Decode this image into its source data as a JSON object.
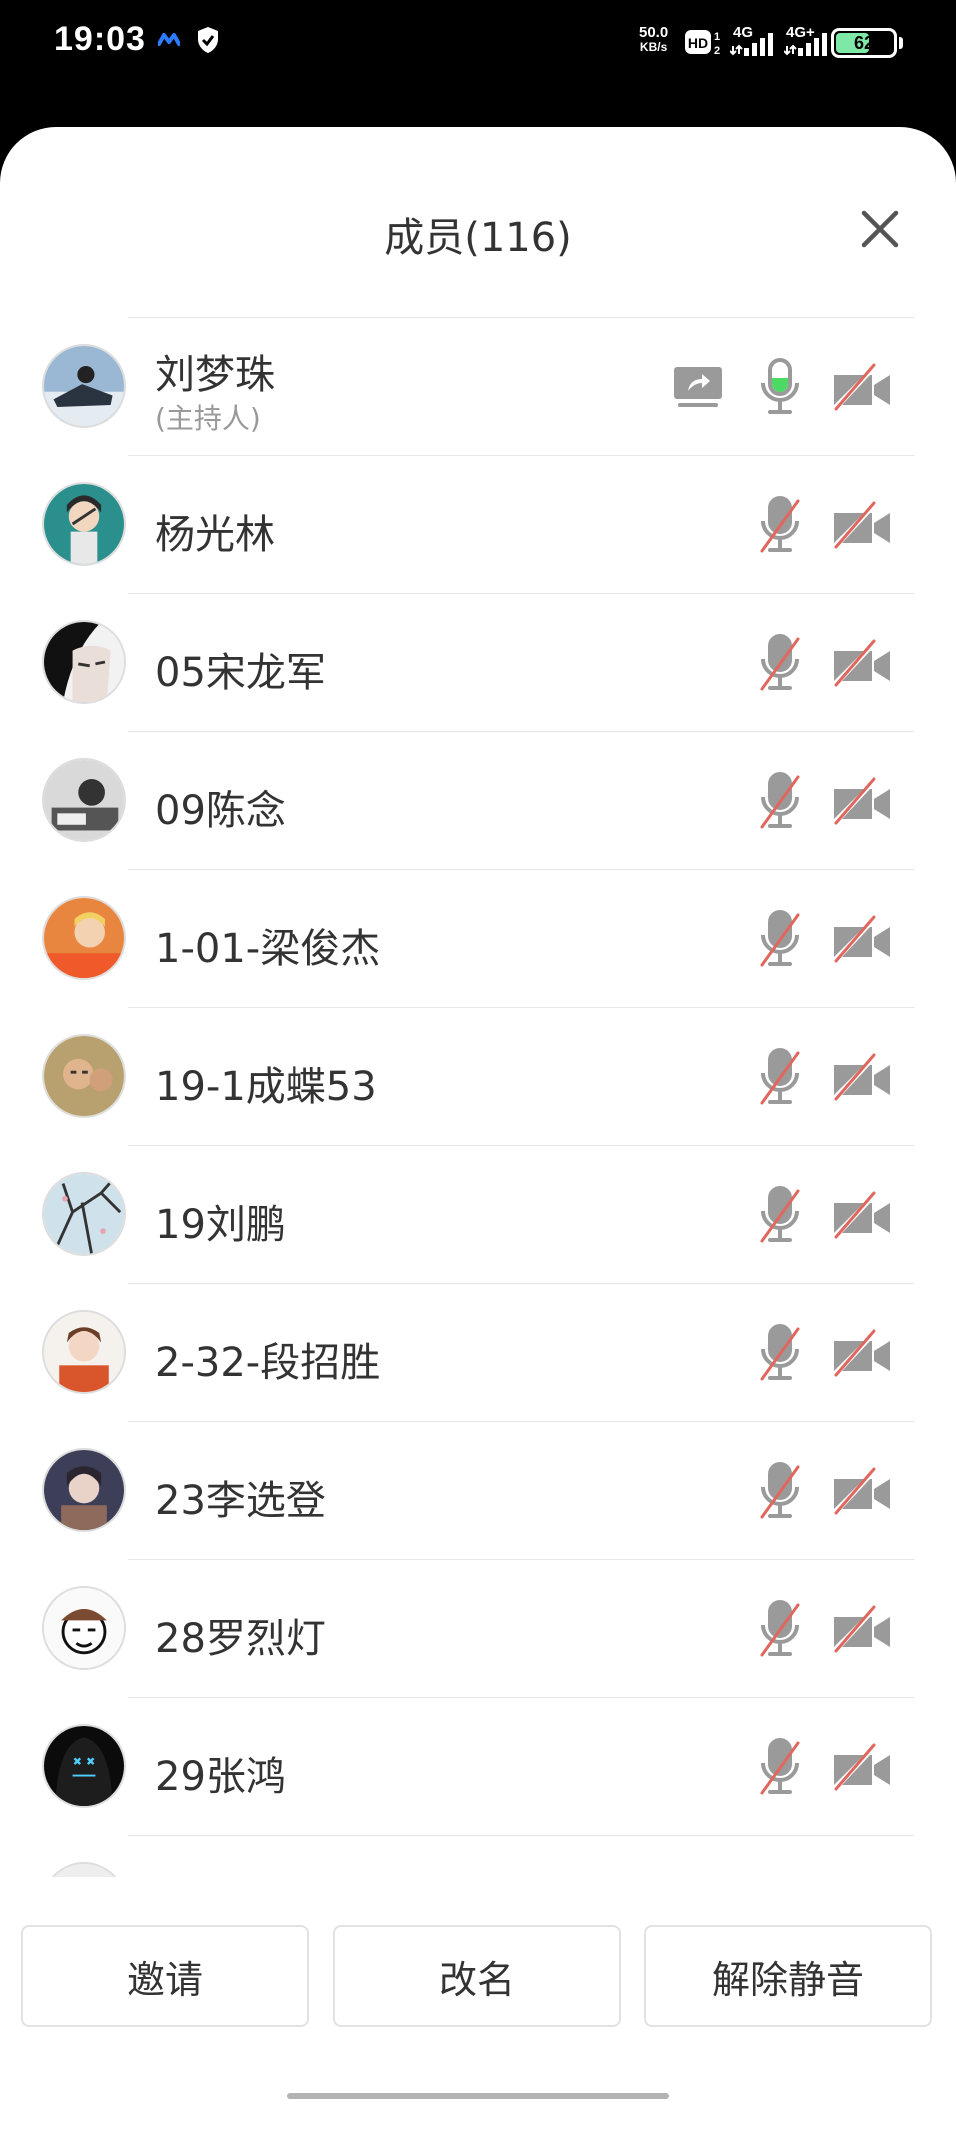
{
  "status_bar": {
    "time": "19:03",
    "speed_value": "50.0",
    "speed_unit": "KB/s",
    "hd_label": "HD",
    "net1": "4G",
    "net2": "4G+",
    "battery": "62",
    "battery_level": 0.62
  },
  "sheet": {
    "title": "成员(116)"
  },
  "members": [
    {
      "name": "刘梦珠",
      "role": "(主持人)",
      "sharing": true,
      "mic_on": true,
      "avatar": "avatar-1"
    },
    {
      "name": " 杨光林",
      "mic_on": false,
      "avatar": "avatar-2"
    },
    {
      "name": "05宋龙军",
      "mic_on": false,
      "avatar": "avatar-3"
    },
    {
      "name": "09陈念",
      "mic_on": false,
      "avatar": "avatar-4"
    },
    {
      "name": "1-01-梁俊杰",
      "mic_on": false,
      "avatar": "avatar-5"
    },
    {
      "name": "19-1成蝶53",
      "mic_on": false,
      "avatar": "avatar-6"
    },
    {
      "name": "19刘鹏",
      "mic_on": false,
      "avatar": "avatar-7"
    },
    {
      "name": "2-32-段招胜",
      "mic_on": false,
      "avatar": "avatar-8"
    },
    {
      "name": "23李选登",
      "mic_on": false,
      "avatar": "avatar-9"
    },
    {
      "name": "28罗烈灯",
      "mic_on": false,
      "avatar": "avatar-10"
    },
    {
      "name": "29张鸿",
      "mic_on": false,
      "avatar": "avatar-11"
    }
  ],
  "footer": {
    "invite_label": "邀请",
    "rename_label": "改名",
    "unmute_label": "解除静音"
  },
  "colors": {
    "mic_active": "#4cd964",
    "muted_slash": "#e0675e",
    "icon_gray": "#9a9a9a"
  }
}
